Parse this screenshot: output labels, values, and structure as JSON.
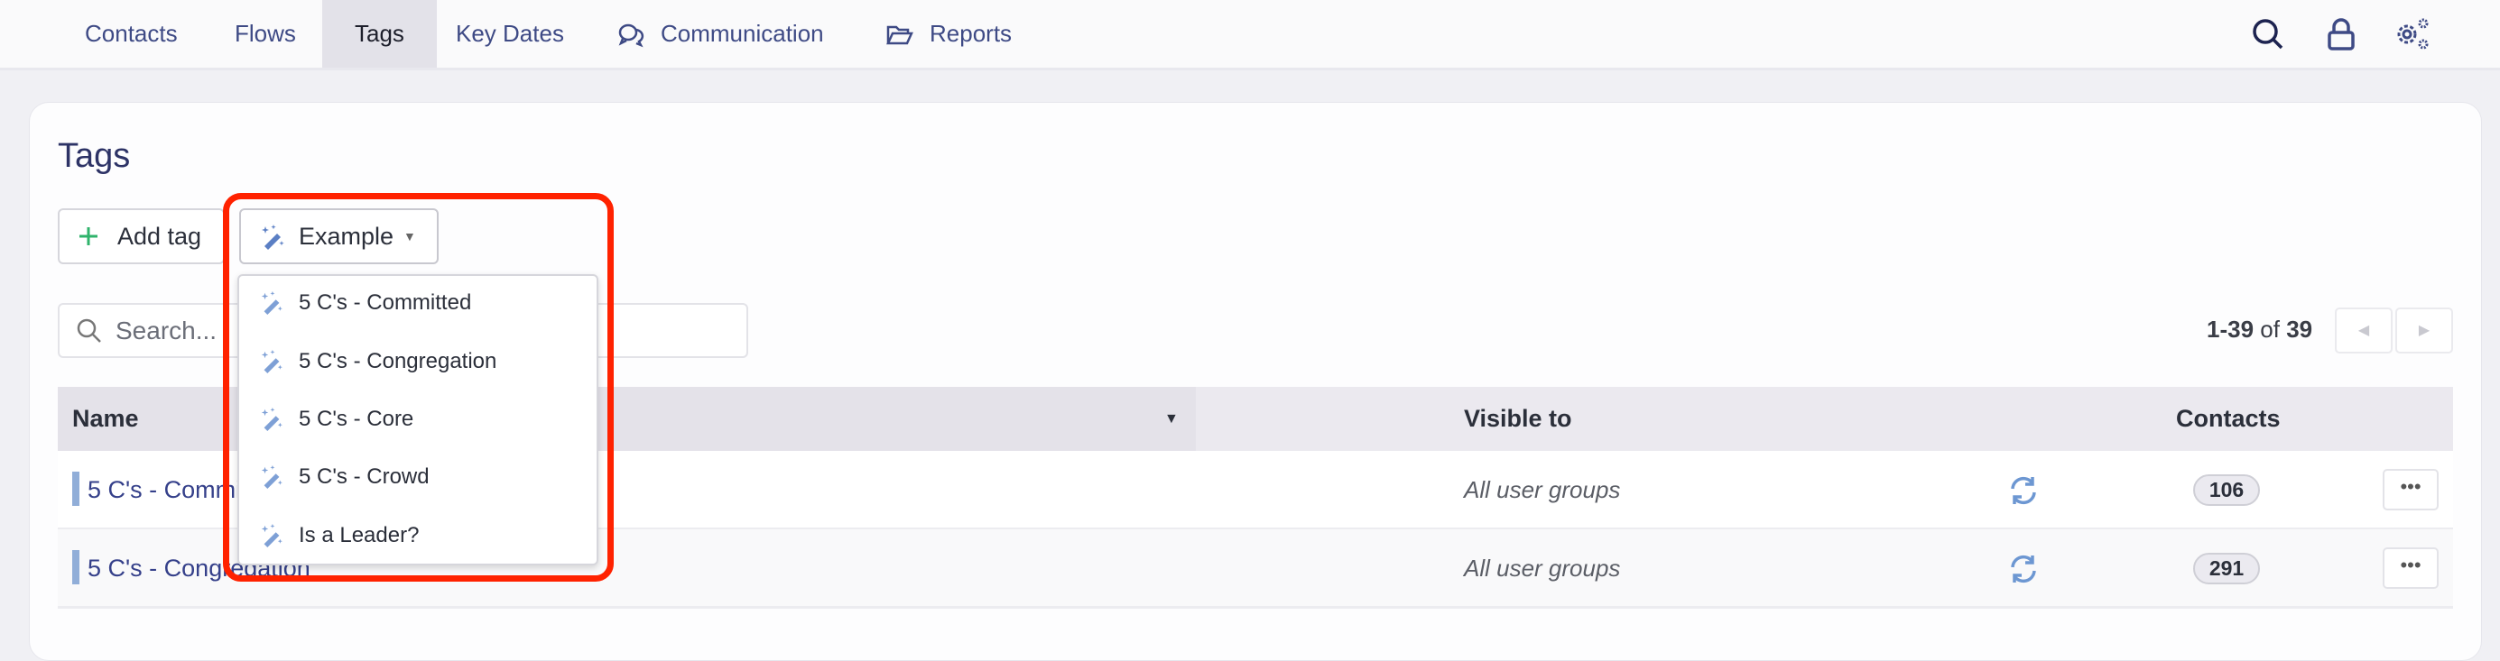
{
  "nav": {
    "items": [
      {
        "label": "Contacts"
      },
      {
        "label": "Flows"
      },
      {
        "label": "Tags",
        "active": true
      },
      {
        "label": "Key Dates"
      },
      {
        "label": "Communication",
        "icon": "chat-bubbles-icon"
      },
      {
        "label": "Reports",
        "icon": "folder-open-icon"
      }
    ],
    "right_icons": [
      "search-icon",
      "lock-icon",
      "gears-icon"
    ]
  },
  "page": {
    "title": "Tags",
    "add_tag_label": "Add tag",
    "example_label": "Example",
    "search_placeholder": "Search..."
  },
  "dropdown": {
    "items": [
      "5 C's - Committed",
      "5 C's - Congregation",
      "5 C's - Core",
      "5 C's - Crowd",
      "Is a Leader?"
    ]
  },
  "pagination": {
    "range": "1-39",
    "of": "of",
    "total": "39"
  },
  "table": {
    "headers": {
      "name": "Name",
      "visible": "Visible to",
      "contacts": "Contacts"
    },
    "rows": [
      {
        "name": "5 C's - Committed",
        "visible": "All user groups",
        "contacts": "106"
      },
      {
        "name": "5 C's - Congregation",
        "visible": "All user groups",
        "contacts": "291"
      }
    ]
  },
  "colors": {
    "accent": "#3e4a85",
    "highlight": "#ff2200",
    "add": "#2fb36b",
    "tagbar": "#91aed8"
  }
}
